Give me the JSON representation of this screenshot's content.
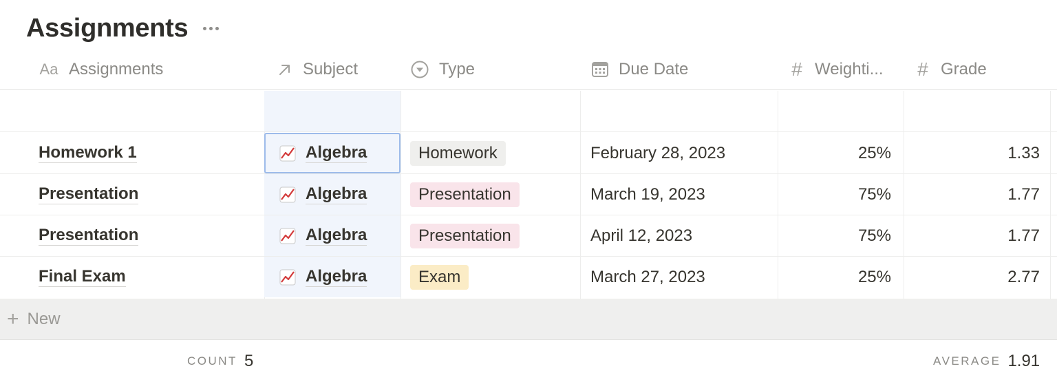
{
  "page": {
    "title": "Assignments"
  },
  "columns": [
    {
      "key": "name",
      "label": "Assignments",
      "icon": "text-property-icon",
      "icon_text": "Aa"
    },
    {
      "key": "subject",
      "label": "Subject",
      "icon": "relation-arrow-icon"
    },
    {
      "key": "type",
      "label": "Type",
      "icon": "select-icon"
    },
    {
      "key": "due",
      "label": "Due Date",
      "icon": "calendar-icon"
    },
    {
      "key": "weight",
      "label": "Weighti...",
      "icon": "number-icon",
      "icon_text": "#"
    },
    {
      "key": "grade",
      "label": "Grade",
      "icon": "number-icon",
      "icon_text": "#"
    }
  ],
  "rows": [
    {
      "name": "Homework 1",
      "subject": "Algebra",
      "type": "Homework",
      "due": "February 28, 2023",
      "weight": "25%",
      "grade": "1.33"
    },
    {
      "name": "Presentation",
      "subject": "Algebra",
      "type": "Presentation",
      "due": "March 19, 2023",
      "weight": "75%",
      "grade": "1.77"
    },
    {
      "name": "Presentation",
      "subject": "Algebra",
      "type": "Presentation",
      "due": "April 12, 2023",
      "weight": "75%",
      "grade": "1.77"
    },
    {
      "name": "Final Exam",
      "subject": "Algebra",
      "type": "Exam",
      "due": "March 27, 2023",
      "weight": "25%",
      "grade": "2.77"
    }
  ],
  "tag_colors": {
    "Homework": "#efefed",
    "Presentation": "#f9e4ea",
    "Exam": "#fbecc6"
  },
  "new_row": {
    "label": "New"
  },
  "footer": {
    "count_label": "COUNT",
    "count_value": "5",
    "average_label": "AVERAGE",
    "average_value": "1.91"
  },
  "colors": {
    "accent_selection": "#9dbbea",
    "selected_column_bg": "#f1f5fc"
  }
}
